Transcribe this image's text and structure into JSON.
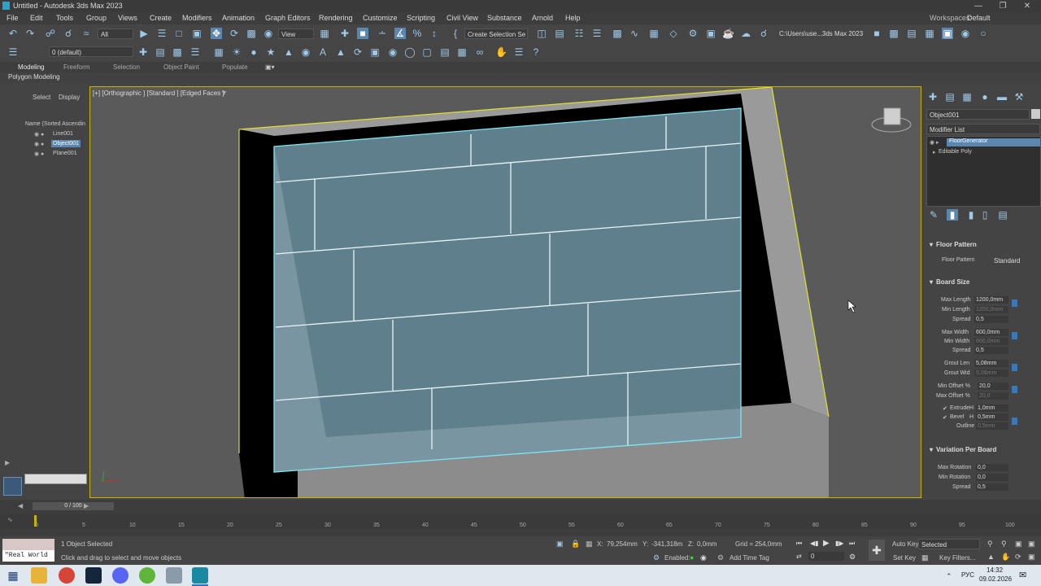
{
  "window": {
    "title": "Untitled - Autodesk 3ds Max 2023"
  },
  "menu": [
    "File",
    "Edit",
    "Tools",
    "Group",
    "Views",
    "Create",
    "Modifiers",
    "Animation",
    "Graph Editors",
    "Rendering",
    "Customize",
    "Scripting",
    "Civil View",
    "Substance",
    "Arnold",
    "Help"
  ],
  "workspaces": {
    "label": "Workspaces:",
    "value": "Default"
  },
  "toolbar": {
    "filter": "All",
    "view": "View",
    "selection_set": "Create Selection Se",
    "path": "C:\\Users\\use...3ds Max 2023",
    "layer": "0 (default)"
  },
  "ribbon": {
    "tabs": [
      "Modeling",
      "Freeform",
      "Selection",
      "Object Paint",
      "Populate"
    ],
    "sub": "Polygon Modeling"
  },
  "scene_explorer": {
    "tabs": [
      "Select",
      "Display"
    ],
    "header": "Name (Sorted Ascendin",
    "items": [
      "Line001",
      "Object001",
      "Plane001"
    ]
  },
  "viewport": {
    "label": "[+] [Orthographic ] [Standard ] [Edged Faces ]"
  },
  "command_panel": {
    "object_name": "Object001",
    "modifier_list": "Modifier List",
    "stack": [
      "FloorGenerator",
      "Editable Poly"
    ],
    "floor_pattern": {
      "title": "Floor Pattern",
      "label": "Floor Pattern",
      "value": "Standard"
    },
    "board_size": {
      "title": "Board Size",
      "rows": [
        {
          "label": "Max Length",
          "value": "1200,0mm",
          "disabled": false
        },
        {
          "label": "Min Length",
          "value": "1200,0mm",
          "disabled": true
        },
        {
          "label": "Spread",
          "value": "0,5",
          "disabled": false
        },
        {
          "label": "Max Width",
          "value": "600,0mm",
          "disabled": false
        },
        {
          "label": "Min Width",
          "value": "600,0mm",
          "disabled": true
        },
        {
          "label": "Spread",
          "value": "0,5",
          "disabled": false
        },
        {
          "label": "Grout Len",
          "value": "5,08mm",
          "disabled": false
        },
        {
          "label": "Grout Wid",
          "value": "5,08mm",
          "disabled": true
        },
        {
          "label": "Min Offset %",
          "value": "20,0",
          "disabled": false
        },
        {
          "label": "Max Offset %",
          "value": "20,0",
          "disabled": true
        }
      ],
      "extrude": {
        "label": "Extrude",
        "h": "H",
        "value": "1,0mm"
      },
      "bevel": {
        "label": "Bevel",
        "h": "H",
        "value": "0,5mm"
      },
      "outline": {
        "label": "Outline",
        "value": "0,5mm"
      }
    },
    "variation": {
      "title": "Variation Per Board",
      "rows": [
        {
          "label": "Max Rotation",
          "value": "0,0"
        },
        {
          "label": "Min Rotation",
          "value": "0,0"
        },
        {
          "label": "Spread",
          "value": "0,5"
        }
      ]
    }
  },
  "timeline": {
    "frame": "0 / 100",
    "ticks": [
      "0",
      "5",
      "10",
      "15",
      "20",
      "25",
      "30",
      "35",
      "40",
      "45",
      "50",
      "55",
      "60",
      "65",
      "70",
      "75",
      "80",
      "85",
      "90",
      "95",
      "100"
    ]
  },
  "status": {
    "maxscript": "\"Real World ",
    "selected": "1 Object Selected",
    "prompt": "Click and drag to select and move objects",
    "x": "79,254mm",
    "y": "-341,318m",
    "z": "0,0mm",
    "grid": "Grid = 254,0mm",
    "enabled": "Enabled:",
    "add_time_tag": "Add Time Tag",
    "auto_key": "Auto Key",
    "set_key": "Set Key",
    "selected_dropdown": "Selected",
    "key_filters": "Key Filters...",
    "frame_field": "0"
  },
  "taskbar": {
    "lang": "РУС",
    "time": "14:32",
    "date": "09.02.2026"
  }
}
